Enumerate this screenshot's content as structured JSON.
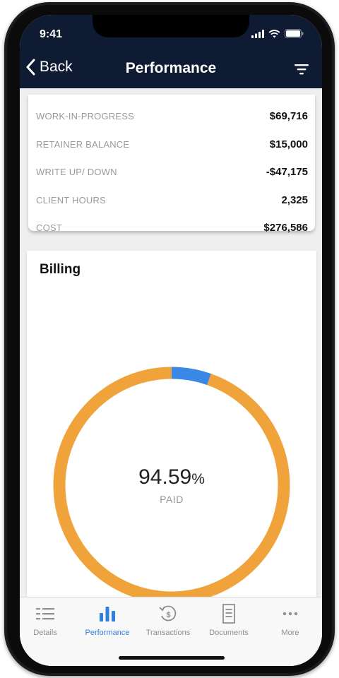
{
  "status_bar": {
    "time": "9:41"
  },
  "nav": {
    "back_label": "Back",
    "title": "Performance"
  },
  "metrics": [
    {
      "label": "WORK-IN-PROGRESS",
      "value": "$69,716"
    },
    {
      "label": "RETAINER BALANCE",
      "value": "$15,000"
    },
    {
      "label": "WRITE UP/ DOWN",
      "value": "-$47,175"
    },
    {
      "label": "CLIENT HOURS",
      "value": "2,325"
    },
    {
      "label": "COST",
      "value": "$276,586"
    }
  ],
  "billing": {
    "title": "Billing",
    "paid_percent_value": "94.59",
    "percent_sign": "%",
    "paid_label": "PAID",
    "paid_fraction": 0.9459,
    "colors": {
      "paid": "#f0a33b",
      "unpaid": "#3a87e6"
    }
  },
  "tabs": [
    {
      "label": "Details",
      "icon": "list-icon",
      "active": false
    },
    {
      "label": "Performance",
      "icon": "bar-chart-icon",
      "active": true
    },
    {
      "label": "Transactions",
      "icon": "transactions-icon",
      "active": false
    },
    {
      "label": "Documents",
      "icon": "document-icon",
      "active": false
    },
    {
      "label": "More",
      "icon": "more-icon",
      "active": false
    }
  ],
  "colors": {
    "header_bg": "#0f1b33",
    "accent": "#2f7fe0"
  }
}
